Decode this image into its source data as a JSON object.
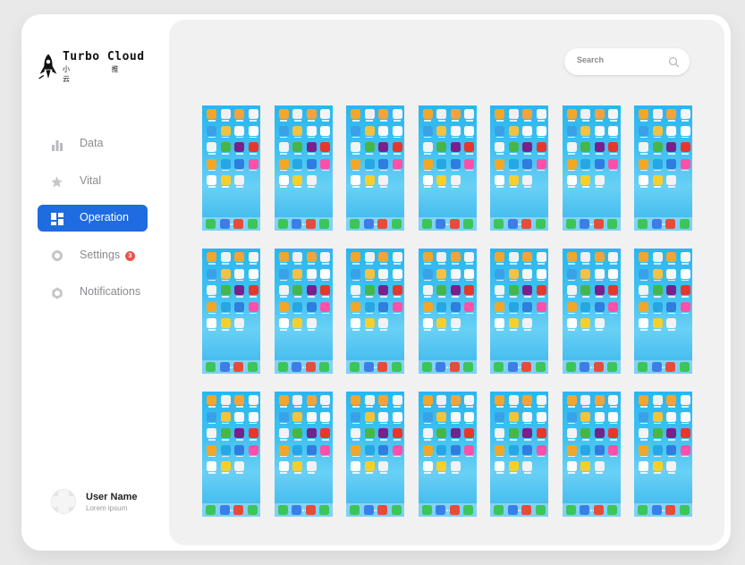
{
  "brand": {
    "title": "Turbo Cloud",
    "subtitle": "小 推 云"
  },
  "nav": {
    "items": [
      {
        "label": "Data",
        "icon": "bar-chart-icon",
        "active": false
      },
      {
        "label": "Vital",
        "icon": "star-icon",
        "active": false
      },
      {
        "label": "Operation",
        "icon": "dashboard-icon",
        "active": true
      },
      {
        "label": "Settings",
        "icon": "gear-icon",
        "active": false,
        "badge": "3"
      },
      {
        "label": "Notifications",
        "icon": "bell-icon",
        "active": false
      }
    ]
  },
  "user": {
    "name": "User Name",
    "subtitle": "Lorem ipsum"
  },
  "search": {
    "placeholder": "Search"
  },
  "devices": {
    "rows": 3,
    "columns": 7
  },
  "colors": {
    "accent": "#1f6be0",
    "badge": "#e9554e",
    "screen": "#2ab6ef"
  }
}
